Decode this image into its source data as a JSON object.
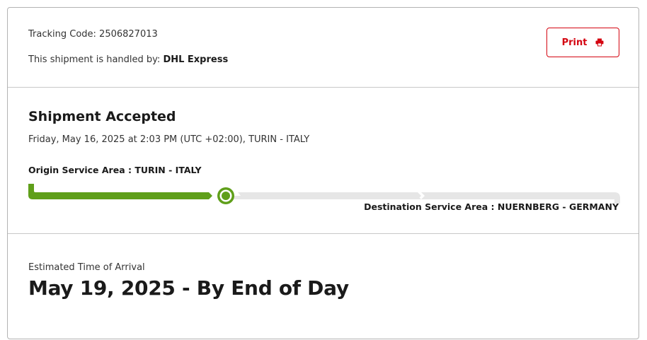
{
  "header": {
    "tracking_prefix": "Tracking Code: ",
    "tracking_code": "2506827013",
    "handled_prefix": "This shipment is handled by: ",
    "carrier": "DHL Express",
    "print_label": "Print",
    "print_icon": "printer-icon",
    "accent_color": "#d40511"
  },
  "status": {
    "title": "Shipment Accepted",
    "datetime": "Friday, May 16, 2025 at 2:03 PM (UTC +02:00), TURIN - ITALY",
    "origin": "Origin Service Area : TURIN - ITALY",
    "destination": "Destination Service Area : NUERNBERG - GERMANY",
    "progress_stage": 1,
    "progress_stages_total": 3,
    "progress_color": "#5f9f1a",
    "track_color": "#e6e6e6"
  },
  "eta": {
    "label": "Estimated Time of Arrival",
    "value": "May 19, 2025 - By End of Day"
  }
}
